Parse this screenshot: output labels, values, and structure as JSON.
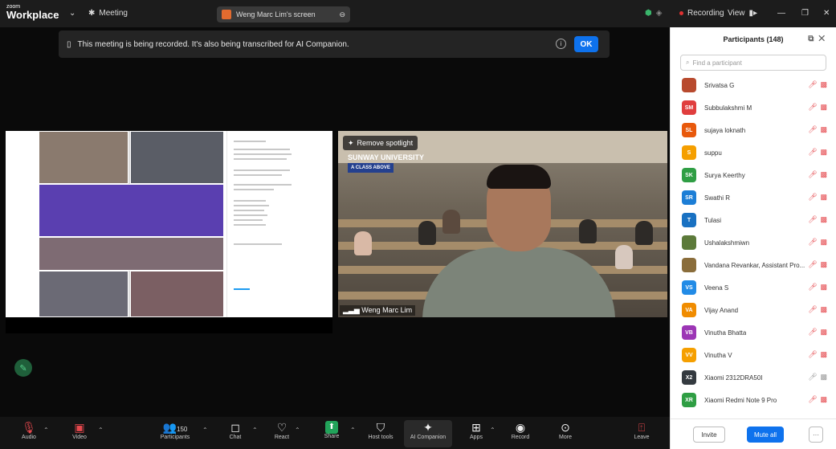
{
  "titlebar": {
    "logo_small": "zoom",
    "logo_big": "Workplace",
    "meeting_label": "Meeting",
    "share_label": "Weng Marc Lim's screen",
    "recording_label": "Recording",
    "view_label": "View"
  },
  "banner": {
    "message": "This meeting is being recorded. It's also being transcribed for AI Companion.",
    "ok_label": "OK"
  },
  "video": {
    "spotlight_label": "Remove spotlight",
    "org_name": "SUNWAY UNIVERSITY",
    "org_tag": "A CLASS ABOVE",
    "speaker_name": "Weng Marc Lim"
  },
  "toolbar": {
    "audio": "Audio",
    "video": "Video",
    "participants": "Participants",
    "participants_count": "150",
    "chat": "Chat",
    "react": "React",
    "share": "Share",
    "host_tools": "Host tools",
    "ai_companion": "AI Companion",
    "apps": "Apps",
    "record": "Record",
    "more": "More",
    "leave": "Leave"
  },
  "panel": {
    "title": "Participants (148)",
    "search_placeholder": "Find a participant",
    "invite_label": "Invite",
    "mute_all_label": "Mute all",
    "more_label": "···",
    "participants": [
      {
        "name": "Srivatsa G",
        "initials": "",
        "color": "#b84a2e"
      },
      {
        "name": "Subbulakshmi M",
        "initials": "SM",
        "color": "#e03e3e"
      },
      {
        "name": "sujaya loknath",
        "initials": "SL",
        "color": "#e8590c"
      },
      {
        "name": "suppu",
        "initials": "S",
        "color": "#f59f00"
      },
      {
        "name": "Surya Keerthy",
        "initials": "SK",
        "color": "#2f9e44"
      },
      {
        "name": "Swathi R",
        "initials": "SR",
        "color": "#1c7ed6"
      },
      {
        "name": "Tulasi",
        "initials": "T",
        "color": "#1971c2"
      },
      {
        "name": "Ushalakshmiwn",
        "initials": "",
        "color": "#5c7a3a"
      },
      {
        "name": "Vandana Revankar, Assistant Pro...",
        "initials": "",
        "color": "#8a6d3b"
      },
      {
        "name": "Veena S",
        "initials": "VS",
        "color": "#228be6"
      },
      {
        "name": "Vijay Anand",
        "initials": "VA",
        "color": "#f08c00"
      },
      {
        "name": "Vinutha Bhatta",
        "initials": "VB",
        "color": "#9c36b5"
      },
      {
        "name": "Vinutha V",
        "initials": "VV",
        "color": "#f59f00"
      },
      {
        "name": "Xiaomi 2312DRA50I",
        "initials": "X2",
        "color": "#343a40"
      },
      {
        "name": "Xiaomi Redmi Note 9 Pro",
        "initials": "XR",
        "color": "#2f9e44"
      }
    ]
  }
}
